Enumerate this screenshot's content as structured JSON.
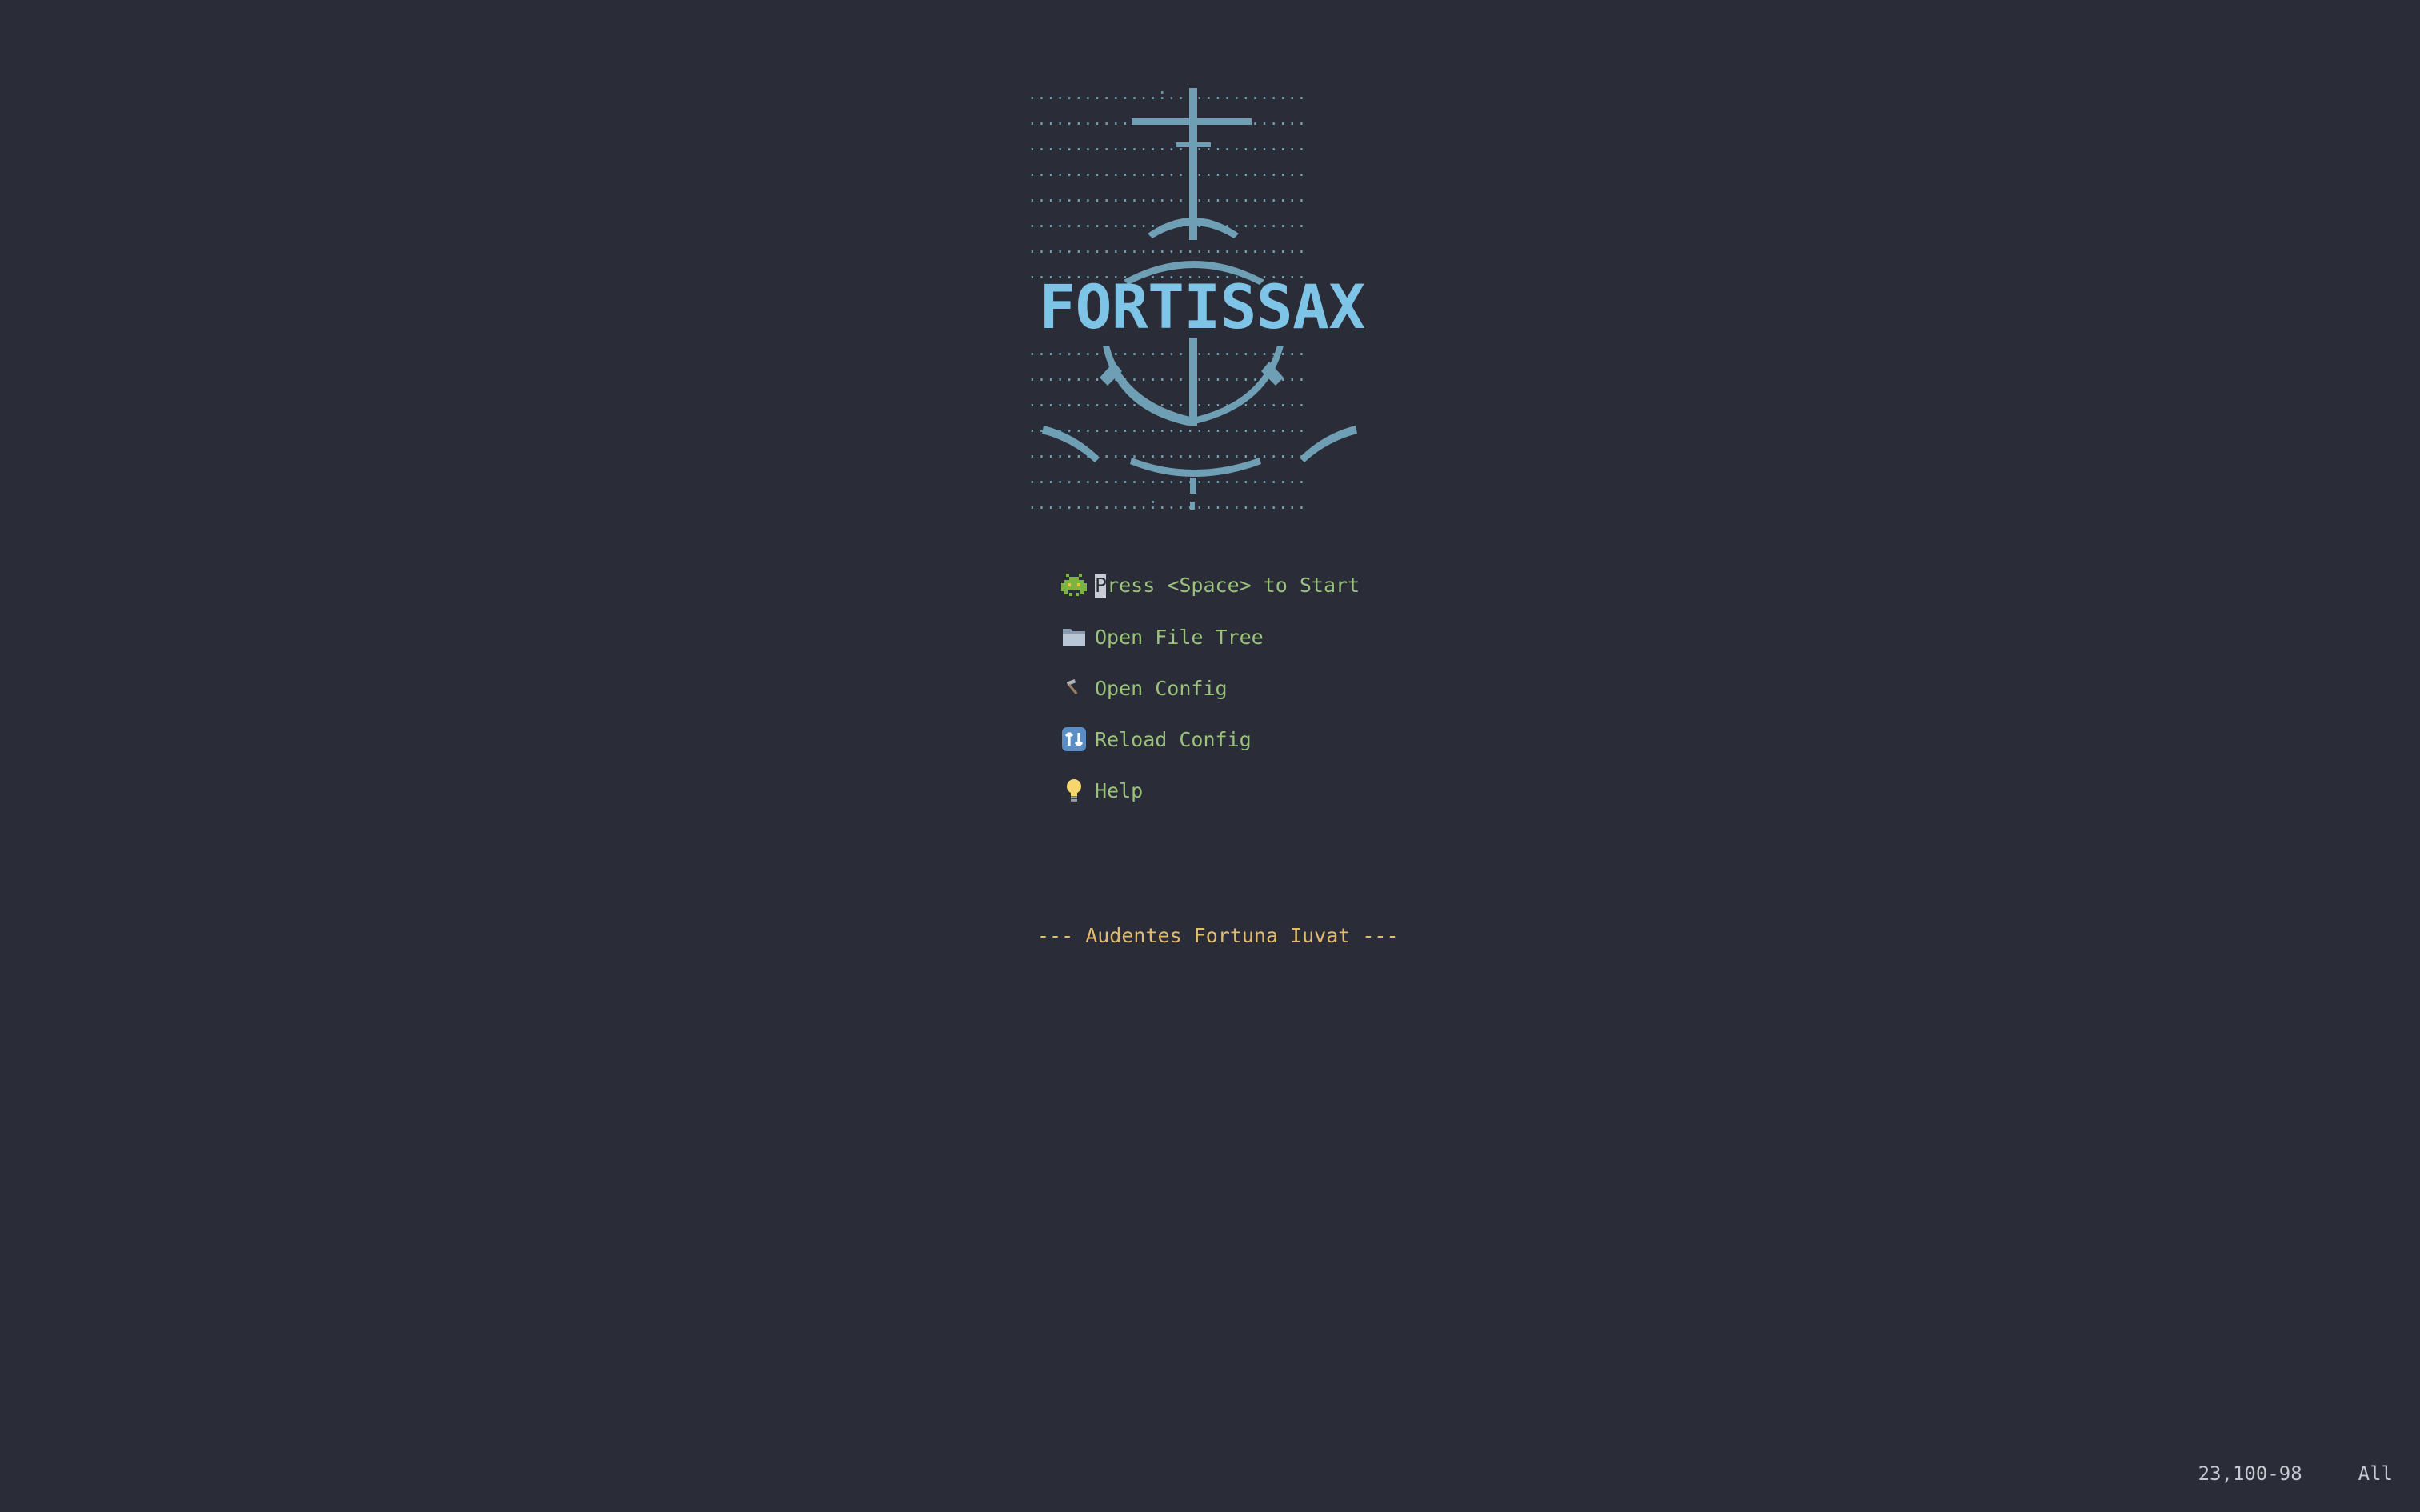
{
  "logo": {
    "text": "FORTISSAX",
    "dot_rows": [
      "..............:...............",
      "..............................",
      "..............................",
      "..............................",
      "..............................",
      "..............................",
      "..............................",
      "..............................",
      "",
      "",
      "..............................",
      "..............................",
      "..............................",
      "..............................",
      "..............................",
      "..............................",
      ".............:................"
    ]
  },
  "menu": {
    "items": [
      {
        "icon": "alien-monster-icon",
        "label": "Press <Space> to Start"
      },
      {
        "icon": "folder-icon",
        "label": "Open File Tree"
      },
      {
        "icon": "hammer-icon",
        "label": "Open Config"
      },
      {
        "icon": "reload-icon",
        "label": "Reload Config"
      },
      {
        "icon": "lightbulb-icon",
        "label": "Help"
      }
    ]
  },
  "footer": {
    "quote": "--- Audentes Fortuna Iuvat ---"
  },
  "statusline": {
    "position": "23,100-98",
    "scroll": "All"
  },
  "colors": {
    "background": "#2a2d38",
    "logo": "#7ec4e6",
    "dots": "#6f9fb4",
    "menu_text": "#9ac27d",
    "quote": "#e2bc6c",
    "statusline": "#c6c9d0"
  }
}
